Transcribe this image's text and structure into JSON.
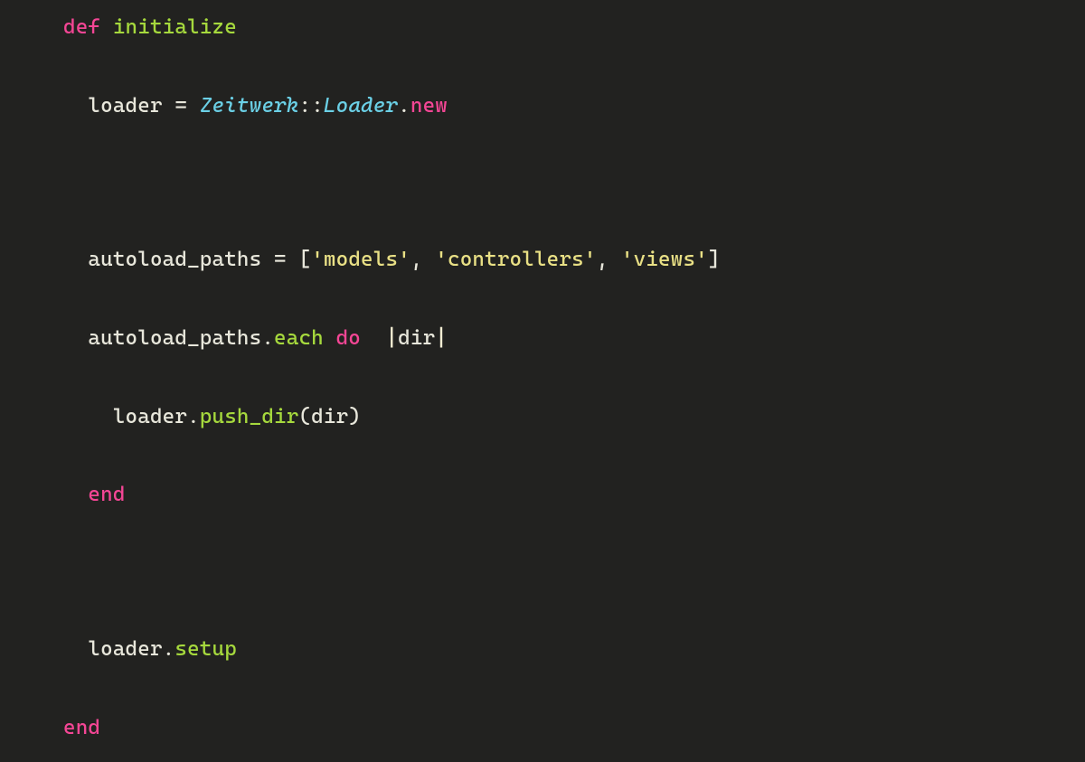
{
  "code": {
    "line1": {
      "def": "def",
      "sp": " ",
      "method": "initialize"
    },
    "line2": {
      "indent": "  ",
      "v": "loader",
      "sp1": " ",
      "eq": "=",
      "sp2": " ",
      "cls1": "Zeitwerk",
      "scope": "::",
      "cls2": "Loader",
      "dot": ".",
      "m": "new"
    },
    "line3": {
      "indent": "  ",
      "v": "autoload_paths",
      "sp1": " ",
      "eq": "=",
      "sp2": " ",
      "lb": "[",
      "s1": "'models'",
      "c1": ",",
      "sp3": " ",
      "s2": "'controllers'",
      "c2": ",",
      "sp4": " ",
      "s3": "'views'",
      "rb": "]"
    },
    "line4": {
      "indent": "  ",
      "v": "autoload_paths",
      "dot": ".",
      "m": "each",
      "sp1": " ",
      "do": "do",
      "sp2": " ",
      "p1": "|",
      "arg": "dir",
      "p2": "|"
    },
    "line5": {
      "indent": "    ",
      "v": "loader",
      "dot": ".",
      "m": "push_dir",
      "lp": "(",
      "arg": "dir",
      "rp": ")"
    },
    "line6": {
      "indent": "  ",
      "end": "end"
    },
    "line7": {
      "indent": "  ",
      "v": "loader",
      "dot": ".",
      "m": "setup"
    },
    "line8": {
      "end": "end"
    }
  }
}
